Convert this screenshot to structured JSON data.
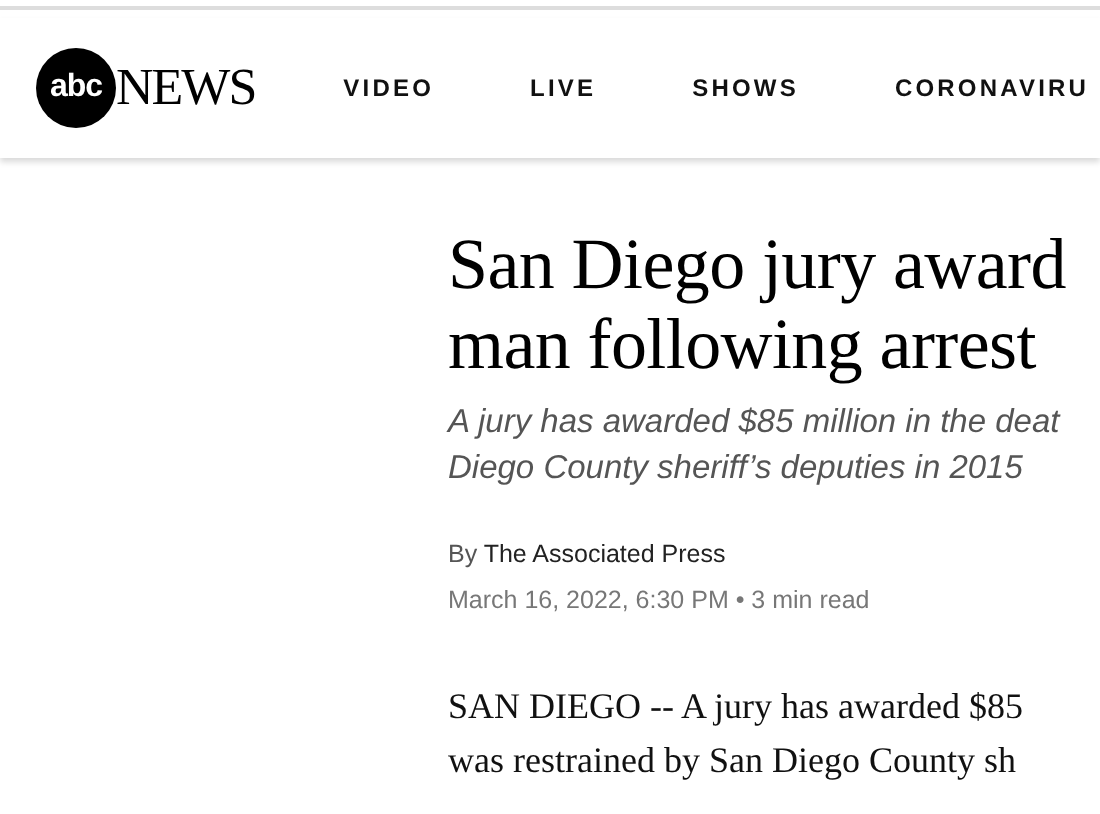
{
  "header": {
    "logo": {
      "badge": "abc",
      "wordmark": "NEWS"
    },
    "nav": [
      "VIDEO",
      "LIVE",
      "SHOWS",
      "CORONAVIRU"
    ]
  },
  "article": {
    "headline_lines": [
      "San Diego jury award",
      "man following arrest"
    ],
    "summary_lines": [
      "A jury has awarded $85 million in the deat",
      "Diego County sheriff’s deputies in 2015"
    ],
    "byline": {
      "prefix": "By",
      "author": "The Associated Press"
    },
    "meta": {
      "date": "March 16, 2022, 6:30 PM",
      "separator": "•",
      "read_time": "3 min read"
    },
    "body_lines": [
      "SAN DIEGO -- A jury has awarded $85",
      "was restrained by San Diego County sh"
    ]
  }
}
